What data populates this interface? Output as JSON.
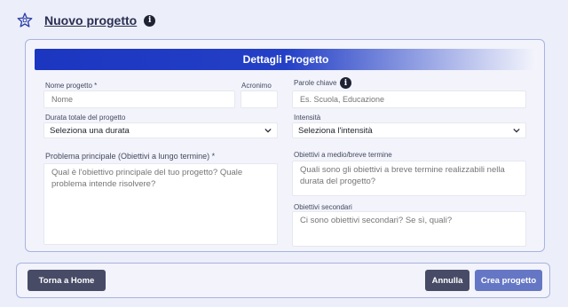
{
  "header": {
    "title": "Nuovo progetto",
    "info_glyph": "i",
    "icon": "star-icon"
  },
  "card": {
    "title": "Dettagli Progetto"
  },
  "form": {
    "nome_label": "Nome progetto *",
    "nome_placeholder": "Nome",
    "acronimo_label": "Acronimo",
    "acronimo_value": "",
    "parole_label": "Parole chiave",
    "parole_placeholder": "Es. Scuola, Educazione",
    "durata_label": "Durata totale del progetto",
    "durata_value": "Seleziona una durata",
    "intensita_label": "Intensità",
    "intensita_value": "Seleziona l'intensità",
    "problema_label": "Problema principale (Obiettivi a lungo termine) *",
    "problema_placeholder": "Qual è l'obiettivo principale del tuo progetto? Quale problema intende risolvere?",
    "obiettivi_medio_label": "Obiettivi a medio/breve termine",
    "obiettivi_medio_placeholder": "Quali sono gli obiettivi a breve termine realizzabili nella durata del progetto?",
    "obiettivi_sec_label": "Obiettivi secondari",
    "obiettivi_sec_placeholder": "Ci sono obiettivi secondari? Se sì, quali?"
  },
  "footer": {
    "home_label": "Torna a Home",
    "cancel_label": "Annulla",
    "create_label": "Crea progetto"
  },
  "colors": {
    "header_gradient_start": "#1b36c0",
    "dark_button": "#474b66",
    "primary_button": "#6577c4",
    "card_border": "#a9b3e0"
  }
}
